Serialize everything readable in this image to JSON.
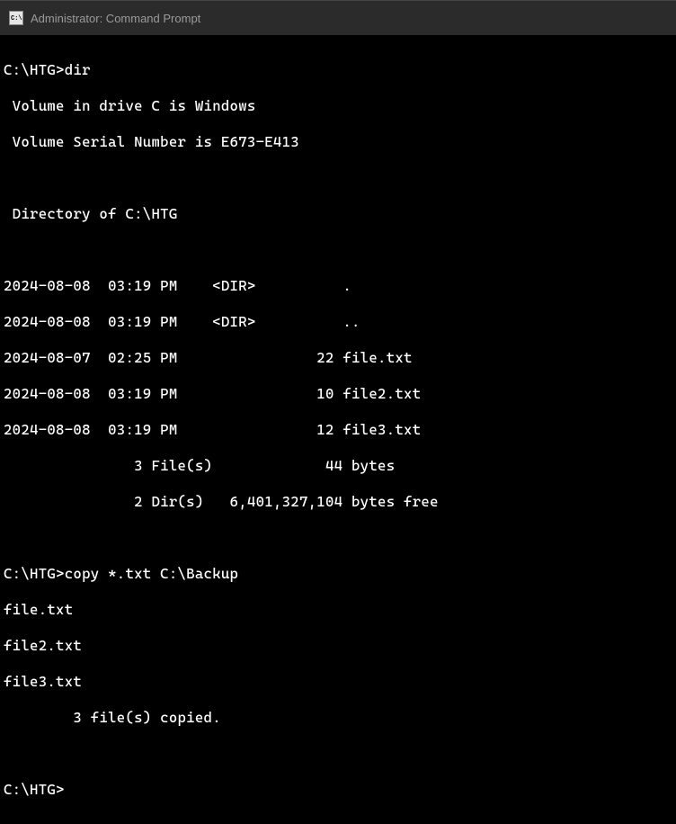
{
  "titlebar": {
    "icon_glyph": "C:\\",
    "title": "Administrator: Command Prompt"
  },
  "terminal": {
    "prompt1": "C:\\HTG>",
    "cmd1": "dir",
    "vol_line": " Volume in drive C is Windows",
    "serial_line": " Volume Serial Number is E673-E413",
    "dir_of": " Directory of C:\\HTG",
    "entry1": "2024-08-08  03:19 PM    <DIR>          .",
    "entry2": "2024-08-08  03:19 PM    <DIR>          ..",
    "entry3": "2024-08-07  02:25 PM                22 file.txt",
    "entry4": "2024-08-08  03:19 PM                10 file2.txt",
    "entry5": "2024-08-08  03:19 PM                12 file3.txt",
    "summary_files": "               3 File(s)             44 bytes",
    "summary_dirs": "               2 Dir(s)   6,401,327,104 bytes free",
    "prompt2": "C:\\HTG>",
    "cmd2": "copy *.txt C:\\Backup",
    "copy1": "file.txt",
    "copy2": "file2.txt",
    "copy3": "file3.txt",
    "copy_summary": "        3 file(s) copied.",
    "prompt3": "C:\\HTG>"
  }
}
